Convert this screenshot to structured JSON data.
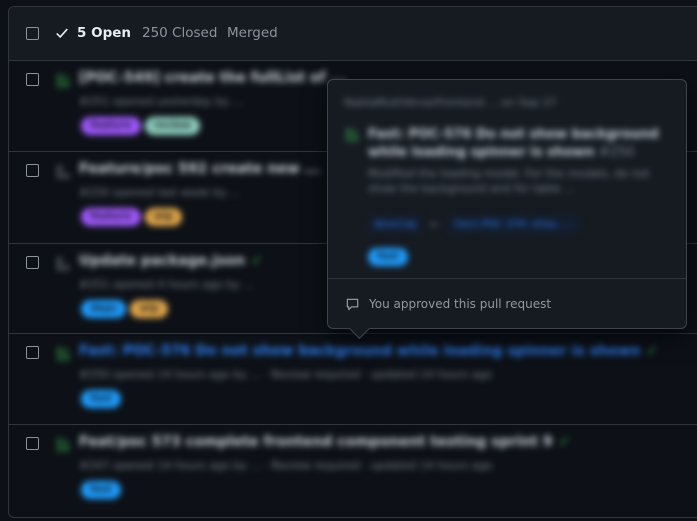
{
  "header": {
    "open_label": "5 Open",
    "closed_label": "250 Closed",
    "merged_label": "Merged"
  },
  "rows": [
    {
      "title": "[POC-549] create the fullList of ...",
      "meta": "#251 opened yesterday by ...",
      "labels": [
        {
          "text": "feature",
          "color": "#a259ff"
        },
        {
          "text": "review",
          "color": "#8fd1c0"
        }
      ]
    },
    {
      "title": "Feature/poc 592 create new ...",
      "meta": "#250 opened last week by ...",
      "labels": [
        {
          "text": "feature",
          "color": "#a259ff"
        },
        {
          "text": "wip",
          "color": "#e3a84b"
        }
      ]
    },
    {
      "title": "Update package.json",
      "meta": "#251 opened 4 hours ago by ...",
      "labels": [
        {
          "text": "deps",
          "color": "#1f9eff"
        },
        {
          "text": "wip",
          "color": "#e3a84b"
        }
      ]
    },
    {
      "title": "Fast: POC-576 Do not show background while loading spinner is shown",
      "meta": "#250 opened 14 hours ago by ... · Review required · updated 14 hours ago",
      "labels": [
        {
          "text": "fast",
          "color": "#1f9eff"
        }
      ]
    },
    {
      "title": "Feat/poc 573 complete frontend component testing sprint 9",
      "meta": "#247 opened 14 hours ago by ... · Review required · updated 14 hours ago",
      "labels": [
        {
          "text": "fast",
          "color": "#1f9eff"
        }
      ]
    }
  ],
  "popover": {
    "repo": "NablaMultiVerse/frontend ... on Sep 27",
    "title": "Fast: POC-576 Do not show background while loading spinner is shown",
    "number": "#250",
    "description": "Modified the loading modal. For the modals, do not show the background and for table ...",
    "base_branch": "develop",
    "head_branch": "fast/POC-576-show...",
    "label": "fast",
    "footer_text": "You approved this pull request"
  },
  "colors": {
    "background": "#0d1117",
    "header_bg": "#161b22",
    "border": "#30363d",
    "link": "#2f81f7",
    "success": "#3fb950"
  }
}
